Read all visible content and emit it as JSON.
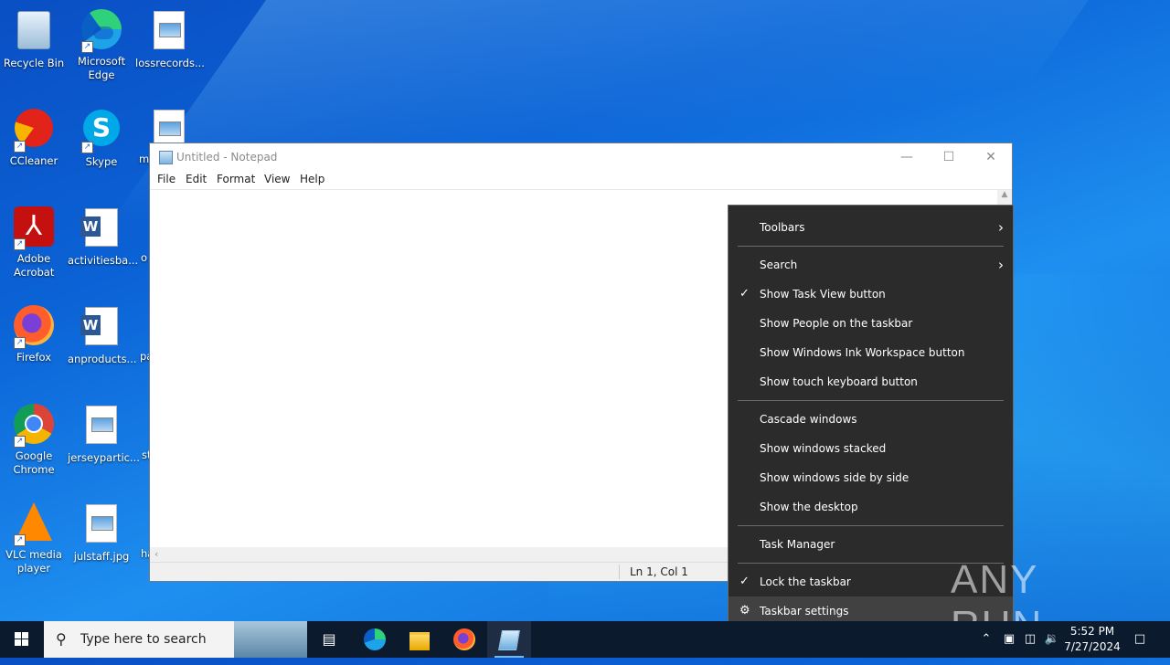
{
  "desktop": {
    "icons": [
      {
        "label": "Recycle Bin"
      },
      {
        "label": "Microsoft Edge"
      },
      {
        "label": "lossrecords..."
      },
      {
        "label": "CCleaner"
      },
      {
        "label": "Skype"
      },
      {
        "label": "Adobe Acrobat"
      },
      {
        "label": "activitiesba..."
      },
      {
        "label": "Firefox"
      },
      {
        "label": "anproducts..."
      },
      {
        "label": "Google Chrome"
      },
      {
        "label": "jerseypartic..."
      },
      {
        "label": "VLC media player"
      },
      {
        "label": "julstaff.jpg"
      }
    ],
    "clipped_labels": [
      "m",
      "o",
      "pa",
      "st",
      "ha"
    ]
  },
  "notepad": {
    "title": "Untitled - Notepad",
    "menu": [
      "File",
      "Edit",
      "Format",
      "View",
      "Help"
    ],
    "status_position": "Ln 1, Col 1"
  },
  "context_menu": {
    "items": [
      {
        "label": "Toolbars",
        "submenu": true
      },
      {
        "label": "Search",
        "submenu": true
      },
      {
        "label": "Show Task View button",
        "checked": true
      },
      {
        "label": "Show People on the taskbar"
      },
      {
        "label": "Show Windows Ink Workspace button"
      },
      {
        "label": "Show touch keyboard button"
      },
      {
        "label": "Cascade windows"
      },
      {
        "label": "Show windows stacked"
      },
      {
        "label": "Show windows side by side"
      },
      {
        "label": "Show the desktop"
      },
      {
        "label": "Task Manager"
      },
      {
        "label": "Lock the taskbar",
        "checked": true
      },
      {
        "label": "Taskbar settings",
        "icon": "gear-icon",
        "highlighted": true
      }
    ]
  },
  "watermark": {
    "text": "ANY RUN"
  },
  "taskbar": {
    "search_placeholder": "Type here to search",
    "apps": [
      "task-view-icon",
      "edge-icon",
      "file-explorer-icon",
      "firefox-icon",
      "notepad-icon"
    ],
    "clock_time": "5:52 PM",
    "clock_date": "7/27/2024"
  },
  "colors": {
    "desktop_bg": "#0b63d6",
    "taskbar_bg": "#0c1a2e",
    "menu_bg": "#2b2b2b",
    "menu_hover": "#414141"
  }
}
